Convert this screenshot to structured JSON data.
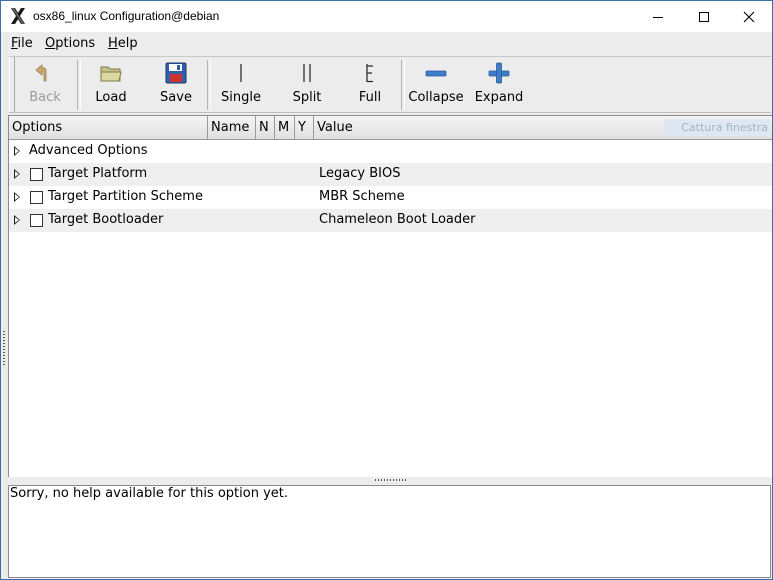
{
  "window": {
    "title": "osx86_linux Configuration@debian",
    "controls": {
      "minimize": "minimize",
      "maximize": "maximize",
      "close": "close"
    }
  },
  "menu": [
    {
      "label_u": "F",
      "label_rest": "ile"
    },
    {
      "label_u": "O",
      "label_rest": "ptions"
    },
    {
      "label_u": "H",
      "label_rest": "elp"
    }
  ],
  "toolbar": {
    "back": "Back",
    "load": "Load",
    "save": "Save",
    "single": "Single",
    "split": "Split",
    "full": "Full",
    "collapse": "Collapse",
    "expand": "Expand"
  },
  "tree": {
    "columns": {
      "options": "Options",
      "name": "Name",
      "n": "N",
      "m": "M",
      "y": "Y",
      "value": "Value"
    },
    "overlay_button": "Cattura finestra",
    "rows": [
      {
        "label": "Advanced Options",
        "value": ""
      },
      {
        "label": "Target Platform",
        "value": "Legacy BIOS"
      },
      {
        "label": "Target Partition Scheme",
        "value": "MBR Scheme"
      },
      {
        "label": "Target Bootloader",
        "value": "Chameleon Boot Loader"
      }
    ]
  },
  "help": {
    "text": "Sorry, no help available for this option yet."
  },
  "colors": {
    "title_border": "#3c6ea8",
    "icon_blue": "#3d7cc9",
    "selection_alt": "#efefef"
  }
}
